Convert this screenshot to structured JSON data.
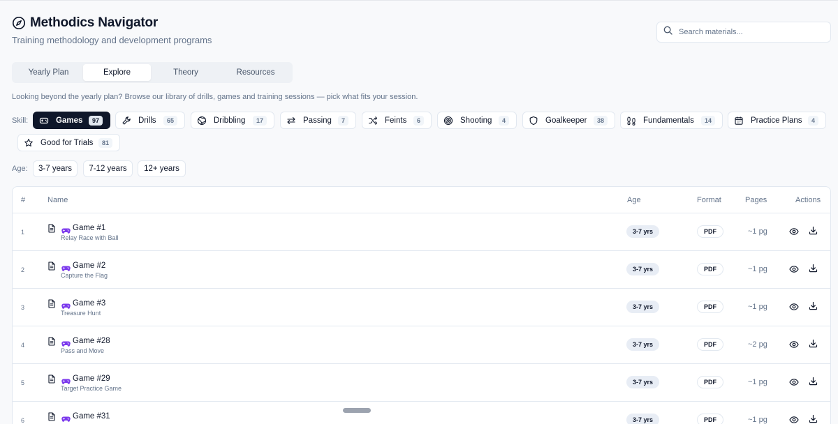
{
  "header": {
    "title": "Methodics Navigator",
    "subtitle": "Training methodology and development programs",
    "title_icon": "compass-icon"
  },
  "search": {
    "placeholder": "Search materials...",
    "value": ""
  },
  "tabs": [
    {
      "label": "Yearly Plan",
      "active": false
    },
    {
      "label": "Explore",
      "active": true
    },
    {
      "label": "Theory",
      "active": false
    },
    {
      "label": "Resources",
      "active": false
    }
  ],
  "intro_text": "Looking beyond the yearly plan? Browse our library of drills, games and training sessions — pick what fits your session.",
  "skills": {
    "label": "Skill:",
    "items": [
      {
        "label": "Games",
        "count": "97",
        "icon": "gamepad-icon",
        "active": true
      },
      {
        "label": "Drills",
        "count": "65",
        "icon": "wrench-icon",
        "active": false
      },
      {
        "label": "Dribbling",
        "count": "17",
        "icon": "ball-icon",
        "active": false
      },
      {
        "label": "Passing",
        "count": "7",
        "icon": "arrows-swap-icon",
        "active": false
      },
      {
        "label": "Feints",
        "count": "6",
        "icon": "shuffle-icon",
        "active": false
      },
      {
        "label": "Shooting",
        "count": "4",
        "icon": "target-icon",
        "active": false
      },
      {
        "label": "Goalkeeper",
        "count": "38",
        "icon": "shield-icon",
        "active": false
      },
      {
        "label": "Fundamentals",
        "count": "14",
        "icon": "footprints-icon",
        "active": false
      },
      {
        "label": "Practice Plans",
        "count": "4",
        "icon": "calendar-icon",
        "active": false
      },
      {
        "label": "Good for Trials",
        "count": "81",
        "icon": "star-icon",
        "active": false
      }
    ]
  },
  "ages": {
    "label": "Age:",
    "items": [
      "3-7 years",
      "7-12 years",
      "12+ years"
    ]
  },
  "table": {
    "columns": {
      "num": "#",
      "name": "Name",
      "age": "Age",
      "format": "Format",
      "pages": "Pages",
      "actions": "Actions"
    },
    "rows": [
      {
        "num": "1",
        "title": "Game #1",
        "subtitle": "Relay Race with Ball",
        "age": "3-7 yrs",
        "format": "PDF",
        "pages": "~1 pg"
      },
      {
        "num": "2",
        "title": "Game #2",
        "subtitle": "Capture the Flag",
        "age": "3-7 yrs",
        "format": "PDF",
        "pages": "~1 pg"
      },
      {
        "num": "3",
        "title": "Game #3",
        "subtitle": "Treasure Hunt",
        "age": "3-7 yrs",
        "format": "PDF",
        "pages": "~1 pg"
      },
      {
        "num": "4",
        "title": "Game #28",
        "subtitle": "Pass and Move",
        "age": "3-7 yrs",
        "format": "PDF",
        "pages": "~2 pg"
      },
      {
        "num": "5",
        "title": "Game #29",
        "subtitle": "Target Practice Game",
        "age": "3-7 yrs",
        "format": "PDF",
        "pages": "~1 pg"
      },
      {
        "num": "6",
        "title": "Game #31",
        "subtitle": "",
        "age": "3-7 yrs",
        "format": "PDF",
        "pages": "~1 pg"
      }
    ]
  },
  "colors": {
    "primary": "#0f172a",
    "muted": "#64748b",
    "border": "#e2e8f0",
    "game_icon": "#7c3aed"
  }
}
